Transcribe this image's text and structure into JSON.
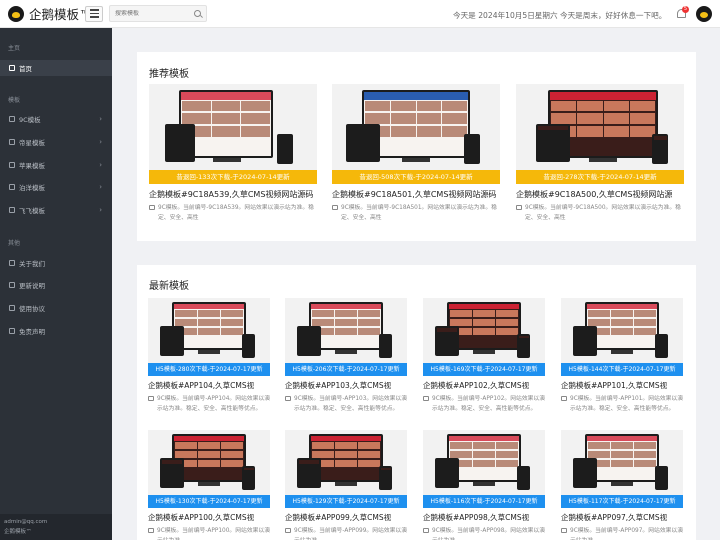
{
  "header": {
    "brand": "企鹅模板™",
    "search_placeholder": "搜索模板",
    "date_text": "今天是 2024年10月5日星期六 今天是周末，好好休息一下吧。",
    "badge_count": "5"
  },
  "sidebar": {
    "section_home": "主页",
    "home_item": "首页",
    "section_templates": "模板",
    "template_items": [
      "9C模板",
      "帝星模板",
      "苹果模板",
      "泊洋模板",
      "飞飞模板"
    ],
    "section_other": "其他",
    "other_items": [
      "关于我们",
      "更新说明",
      "使用协议",
      "免责声明"
    ],
    "footer_email": "admin@qq.com",
    "footer_brand": "企鹅模板™"
  },
  "recommended": {
    "title": "推荐模板",
    "items": [
      {
        "badge": "昔退回-133次下载-于2024-07-14更新",
        "title": "企鹅模板#9C18A539,久草CMS视频网站源码",
        "desc": "9C模板。当前编号-9C18A539。网站效果以演示站为准。稳定、安全、高性"
      },
      {
        "badge": "昔退回-508次下载-于2024-07-14更新",
        "title": "企鹅模板#9C18A501,久草CMS视频网站源码",
        "desc": "9C模板。当前编号-9C18A501。网站效果以演示站为准。稳定、安全、高性"
      },
      {
        "badge": "昔退回-278次下载-于2024-07-14更新",
        "title": "企鹅模板#9C18A500,久草CMS视频网站源",
        "desc": "9C模板。当前编号-9C18A500。网站效果以演示站为准。稳定、安全、高性"
      }
    ]
  },
  "latest": {
    "title": "最新模板",
    "items": [
      {
        "badge": "H5模板-280次下载-于2024-07-17更新",
        "title": "企鹅模板#APP104,久草CMS视",
        "desc": "9C模板。当前编号-APP104。网站效果以演示站为准。稳定、安全、高性能等优点。"
      },
      {
        "badge": "H5模板-206次下载-于2024-07-17更新",
        "title": "企鹅模板#APP103,久草CMS视",
        "desc": "9C模板。当前编号-APP103。网站效果以演示站为准。稳定、安全、高性能等优点。"
      },
      {
        "badge": "H5模板-169次下载-于2024-07-17更新",
        "title": "企鹅模板#APP102,久草CMS视",
        "desc": "9C模板。当前编号-APP102。网站效果以演示站为准。稳定、安全、高性能等优点。"
      },
      {
        "badge": "H5模板-144次下载-于2024-07-17更新",
        "title": "企鹅模板#APP101,久草CMS视",
        "desc": "9C模板。当前编号-APP101。网站效果以演示站为准。稳定、安全、高性能等优点。"
      },
      {
        "badge": "H5模板-130次下载-于2024-07-17更新",
        "title": "企鹅模板#APP100,久草CMS视",
        "desc": "9C模板。当前编号-APP100。网站效果以演示站为准。"
      },
      {
        "badge": "H5模板-129次下载-于2024-07-17更新",
        "title": "企鹅模板#APP099,久草CMS视",
        "desc": "9C模板。当前编号-APP099。网站效果以演示站为准。"
      },
      {
        "badge": "H5模板-116次下载-于2024-07-17更新",
        "title": "企鹅模板#APP098,久草CMS视",
        "desc": "9C模板。当前编号-APP098。网站效果以演示站为准。"
      },
      {
        "badge": "H5模板-117次下载-于2024-07-17更新",
        "title": "企鹅模板#APP097,久草CMS视",
        "desc": "9C模板。当前编号-APP097。网站效果以演示站为准。"
      }
    ]
  }
}
